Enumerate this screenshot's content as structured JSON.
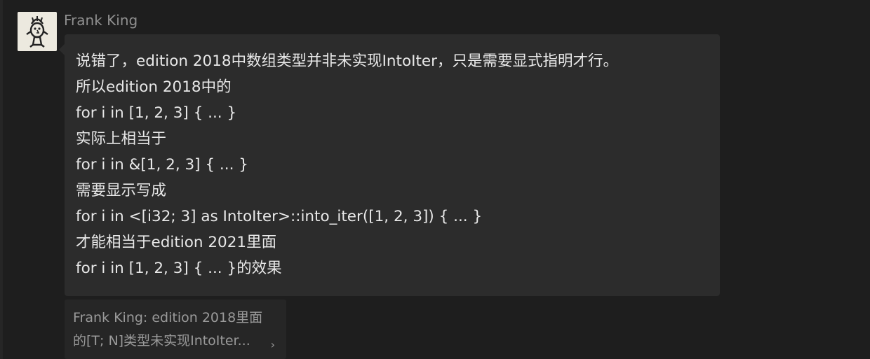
{
  "message": {
    "sender": "Frank King",
    "lines": [
      "说错了，edition 2018中数组类型并非未实现IntoIter，只是需要显式指明才行。",
      "所以edition 2018中的",
      "for i in [1, 2, 3] { ... }",
      "实际上相当于",
      "for i in &[1, 2, 3] { ... }",
      "需要显示写成",
      "for i in <[i32; 3] as IntoIter>::into_iter([1, 2, 3]) { ... }",
      "才能相当于edition 2021里面",
      "for i in [1, 2, 3] { ... }的效果"
    ]
  },
  "quote": {
    "line1": "Frank King: edition 2018里面",
    "line2": "的[T; N]类型未实现IntoIter...",
    "chevron": "›"
  },
  "icons": {
    "avatar": "cartoon-avatar-icon",
    "quote_chevron": "chevron-right-icon"
  },
  "colors": {
    "background": "#1e1e1e",
    "bubble": "#2c2c2c",
    "quote_bg": "#262626",
    "text": "#e8e8e8",
    "muted": "#8f8f8f"
  }
}
